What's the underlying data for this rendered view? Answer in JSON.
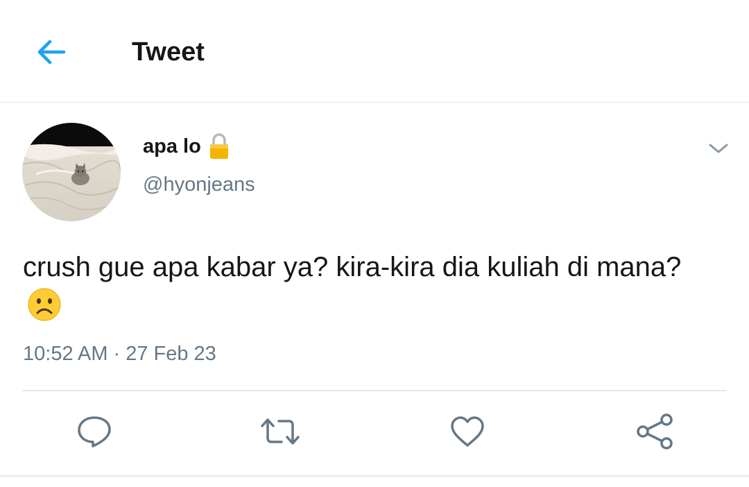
{
  "header": {
    "title": "Tweet",
    "back_icon": "arrow-left-icon",
    "accent_color": "#1da1f2"
  },
  "tweet": {
    "author": {
      "display_name": "apa lo",
      "locked_icon": "lock-icon",
      "handle": "@hyonjeans",
      "avatar": "avatar-kitten-on-bed"
    },
    "text": "crush gue apa kabar ya? kira-kira dia kuliah di mana?",
    "emoji": "frowning-face-emoji",
    "time": "10:52 AM",
    "separator": "·",
    "date": "27 Feb 23",
    "menu_icon": "chevron-down-icon"
  },
  "actions": [
    {
      "name": "reply",
      "icon": "reply-icon"
    },
    {
      "name": "retweet",
      "icon": "retweet-icon"
    },
    {
      "name": "like",
      "icon": "heart-icon"
    },
    {
      "name": "share",
      "icon": "share-icon"
    }
  ],
  "colors": {
    "primary_text": "#14171a",
    "secondary_text": "#657786",
    "divider": "#e1e8ed",
    "icon_gray": "#657786"
  }
}
